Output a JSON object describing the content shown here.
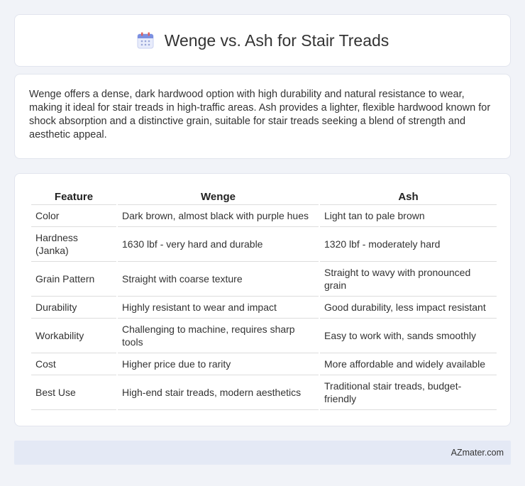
{
  "header": {
    "title": "Wenge vs. Ash for Stair Treads",
    "icon": "calendar-icon"
  },
  "intro": {
    "text": "Wenge offers a dense, dark hardwood option with high durability and natural resistance to wear, making it ideal for stair treads in high-traffic areas. Ash provides a lighter, flexible hardwood known for shock absorption and a distinctive grain, suitable for stair treads seeking a blend of strength and aesthetic appeal."
  },
  "table": {
    "headers": [
      "Feature",
      "Wenge",
      "Ash"
    ],
    "rows": [
      [
        "Color",
        "Dark brown, almost black with purple hues",
        "Light tan to pale brown"
      ],
      [
        "Hardness (Janka)",
        "1630 lbf - very hard and durable",
        "1320 lbf - moderately hard"
      ],
      [
        "Grain Pattern",
        "Straight with coarse texture",
        "Straight to wavy with pronounced grain"
      ],
      [
        "Durability",
        "Highly resistant to wear and impact",
        "Good durability, less impact resistant"
      ],
      [
        "Workability",
        "Challenging to machine, requires sharp tools",
        "Easy to work with, sands smoothly"
      ],
      [
        "Cost",
        "Higher price due to rarity",
        "More affordable and widely available"
      ],
      [
        "Best Use",
        "High-end stair treads, modern aesthetics",
        "Traditional stair treads, budget-friendly"
      ]
    ]
  },
  "footer": {
    "text": "AZmater.com"
  },
  "colors": {
    "page_bg": "#f1f3f8",
    "card_bg": "#ffffff",
    "footer_bg": "#e4e9f5"
  }
}
